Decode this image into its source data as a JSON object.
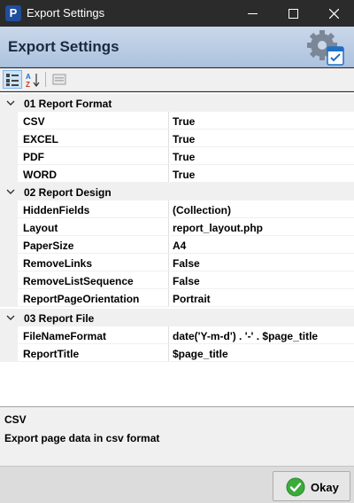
{
  "window": {
    "title": "Export Settings",
    "app_icon_letter": "P"
  },
  "header": {
    "title": "Export Settings",
    "icon": "gear-settings-icon"
  },
  "toolbar": {
    "buttons": [
      {
        "name": "categorized-view",
        "icon": "categorized-icon",
        "active": true
      },
      {
        "name": "alphabetical-sort",
        "icon": "sort-az-icon",
        "active": false
      },
      {
        "name": "property-pages",
        "icon": "property-pages-icon",
        "active": false
      }
    ]
  },
  "grid": {
    "categories": [
      {
        "label": "01 Report Format",
        "props": [
          {
            "name": "CSV",
            "value": "True"
          },
          {
            "name": "EXCEL",
            "value": "True"
          },
          {
            "name": "PDF",
            "value": "True"
          },
          {
            "name": "WORD",
            "value": "True"
          }
        ]
      },
      {
        "label": "02 Report Design",
        "props": [
          {
            "name": "HiddenFields",
            "value": "(Collection)"
          },
          {
            "name": "Layout",
            "value": "report_layout.php"
          },
          {
            "name": "PaperSize",
            "value": "A4"
          },
          {
            "name": "RemoveLinks",
            "value": "False"
          },
          {
            "name": "RemoveListSequence",
            "value": "False"
          },
          {
            "name": "ReportPageOrientation",
            "value": "Portrait"
          }
        ]
      },
      {
        "label": "03 Report File",
        "props": [
          {
            "name": "FileNameFormat",
            "value": "date('Y-m-d') . '-' . $page_title"
          },
          {
            "name": "ReportTitle",
            "value": "$page_title"
          }
        ]
      }
    ]
  },
  "description": {
    "title": "CSV",
    "text": "Export page data in csv format"
  },
  "footer": {
    "ok_label": "Okay"
  },
  "colors": {
    "header_bg": "#b9cce4",
    "titlebar_bg": "#2b2b2b",
    "ok_green": "#3cab3c"
  }
}
